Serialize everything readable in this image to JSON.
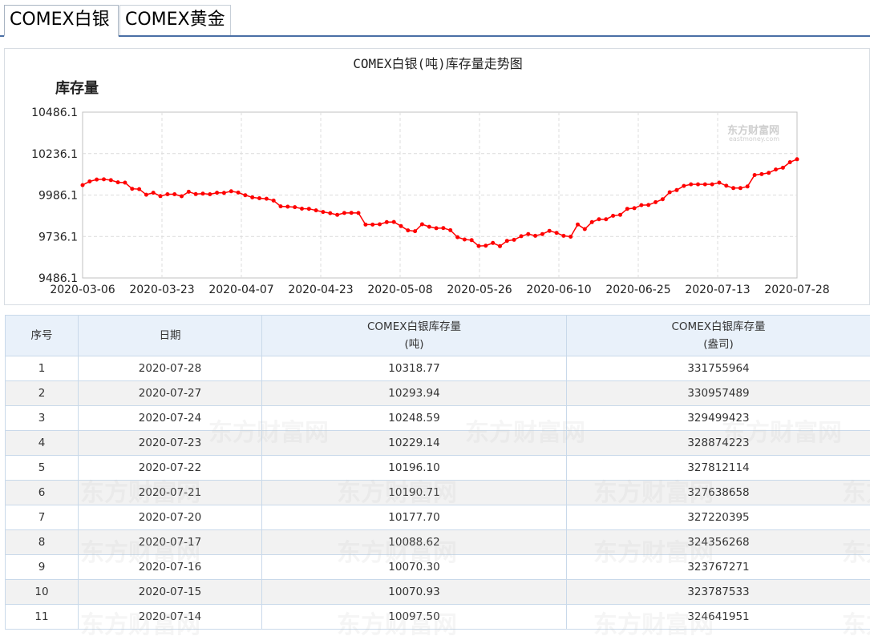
{
  "tabs": [
    {
      "label": "COMEX白银",
      "active": true
    },
    {
      "label": "COMEX黄金",
      "active": false
    }
  ],
  "watermark": {
    "cn": "东方财富网",
    "en": "eastmoney.com"
  },
  "chart_data": {
    "type": "line",
    "title": "COMEX白银(吨)库存量走势图",
    "ylabel": "库存量",
    "xlabel": "",
    "ylim": [
      9486.1,
      10486.1
    ],
    "yticks": [
      "10486.1",
      "10236.1",
      "9986.1",
      "9736.1",
      "9486.1"
    ],
    "xticks": [
      "2020-03-06",
      "2020-03-23",
      "2020-04-07",
      "2020-04-23",
      "2020-05-08",
      "2020-05-26",
      "2020-06-10",
      "2020-06-25",
      "2020-07-13",
      "2020-07-28"
    ],
    "grid": true,
    "color": "#ff0000",
    "series": [
      {
        "values": [
          10046,
          10068,
          10080,
          10081,
          10076,
          10063,
          10061,
          10024,
          10022,
          9988,
          10000,
          9980,
          9991,
          9991,
          9979,
          10006,
          9992,
          9995,
          9991,
          10000,
          9999,
          10009,
          10001,
          9985,
          9972,
          9967,
          9964,
          9953,
          9918,
          9916,
          9913,
          9904,
          9903,
          9894,
          9884,
          9877,
          9867,
          9878,
          9879,
          9878,
          9808,
          9808,
          9810,
          9823,
          9824,
          9799,
          9773,
          9768,
          9810,
          9795,
          9786,
          9787,
          9774,
          9732,
          9718,
          9714,
          9679,
          9681,
          9697,
          9678,
          9710,
          9716,
          9738,
          9751,
          9740,
          9751,
          9770,
          9758,
          9740,
          9735,
          9809,
          9781,
          9823,
          9840,
          9840,
          9861,
          9867,
          9903,
          9907,
          9925,
          9926,
          9943,
          9961,
          10003,
          10016,
          10041,
          10051,
          10051,
          10051,
          10051,
          10061,
          10042,
          10028,
          10028,
          10038,
          10107,
          10112,
          10120,
          10140,
          10151,
          10184,
          10202
        ]
      }
    ]
  },
  "table": {
    "headers": {
      "no": "序号",
      "date": "日期",
      "tons_line1": "COMEX白银库存量",
      "tons_line2": "(吨)",
      "oz_line1": "COMEX白银库存量",
      "oz_line2": "(盎司)"
    },
    "rows": [
      {
        "no": "1",
        "date": "2020-07-28",
        "tons": "10318.77",
        "oz": "331755964"
      },
      {
        "no": "2",
        "date": "2020-07-27",
        "tons": "10293.94",
        "oz": "330957489"
      },
      {
        "no": "3",
        "date": "2020-07-24",
        "tons": "10248.59",
        "oz": "329499423"
      },
      {
        "no": "4",
        "date": "2020-07-23",
        "tons": "10229.14",
        "oz": "328874223"
      },
      {
        "no": "5",
        "date": "2020-07-22",
        "tons": "10196.10",
        "oz": "327812114"
      },
      {
        "no": "6",
        "date": "2020-07-21",
        "tons": "10190.71",
        "oz": "327638658"
      },
      {
        "no": "7",
        "date": "2020-07-20",
        "tons": "10177.70",
        "oz": "327220395"
      },
      {
        "no": "8",
        "date": "2020-07-17",
        "tons": "10088.62",
        "oz": "324356268"
      },
      {
        "no": "9",
        "date": "2020-07-16",
        "tons": "10070.30",
        "oz": "323767271"
      },
      {
        "no": "10",
        "date": "2020-07-15",
        "tons": "10070.93",
        "oz": "323787533"
      },
      {
        "no": "11",
        "date": "2020-07-14",
        "tons": "10097.50",
        "oz": "324641951"
      }
    ]
  }
}
